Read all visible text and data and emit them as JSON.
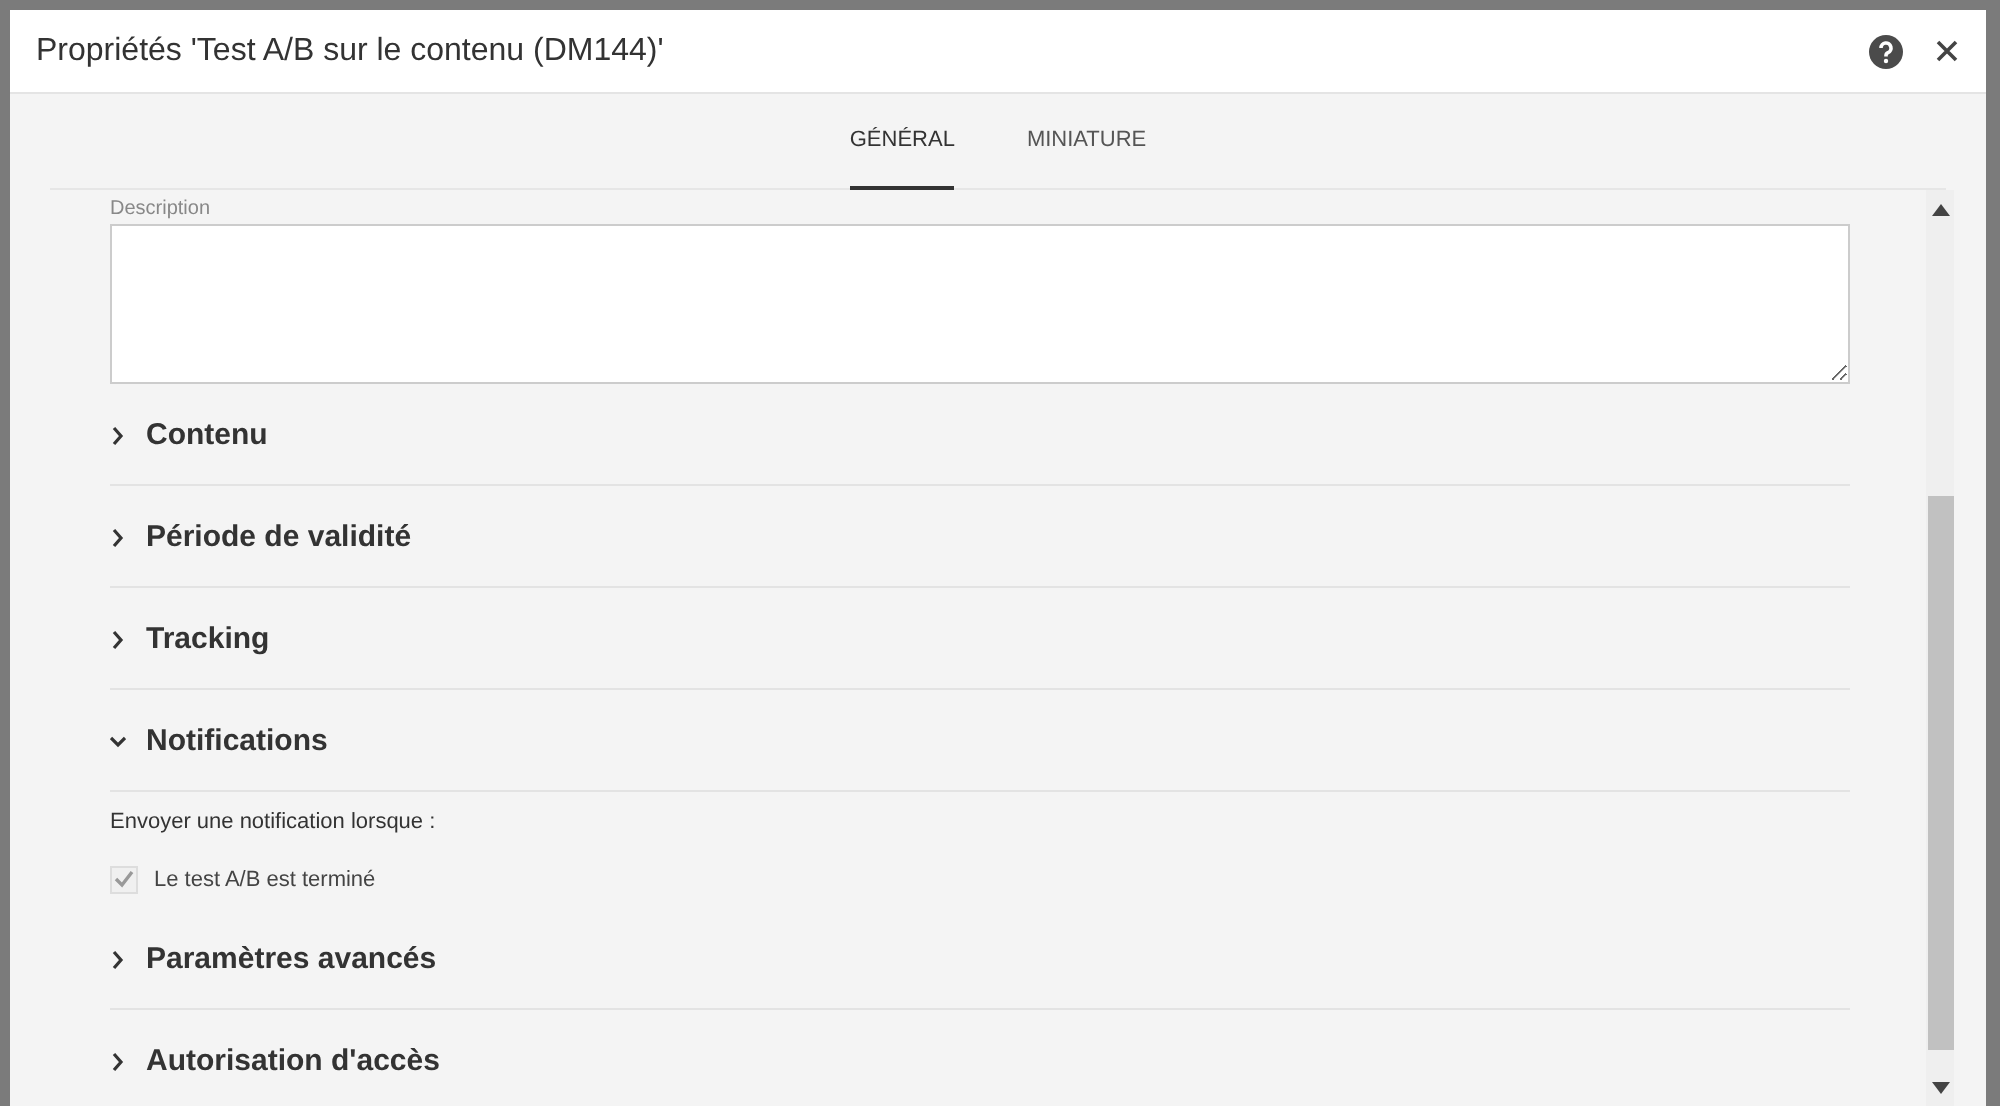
{
  "dialog": {
    "title": "Propriétés 'Test A/B sur le contenu (DM144)'"
  },
  "tabs": [
    {
      "label": "GÉNÉRAL",
      "selected": true
    },
    {
      "label": "MINIATURE",
      "selected": false
    }
  ],
  "description": {
    "label": "Description"
  },
  "sections": [
    {
      "title": "Contenu",
      "expanded": false
    },
    {
      "title": "Période de validité",
      "expanded": false
    },
    {
      "title": "Tracking",
      "expanded": false
    },
    {
      "title": "Notifications",
      "expanded": true,
      "intro": "Envoyer une notification lorsque :",
      "options": [
        {
          "label": "Le test A/B est terminé",
          "checked": true,
          "disabled": true
        }
      ]
    },
    {
      "title": "Paramètres avancés",
      "expanded": false
    },
    {
      "title": "Autorisation d'accès",
      "expanded": false
    }
  ]
}
